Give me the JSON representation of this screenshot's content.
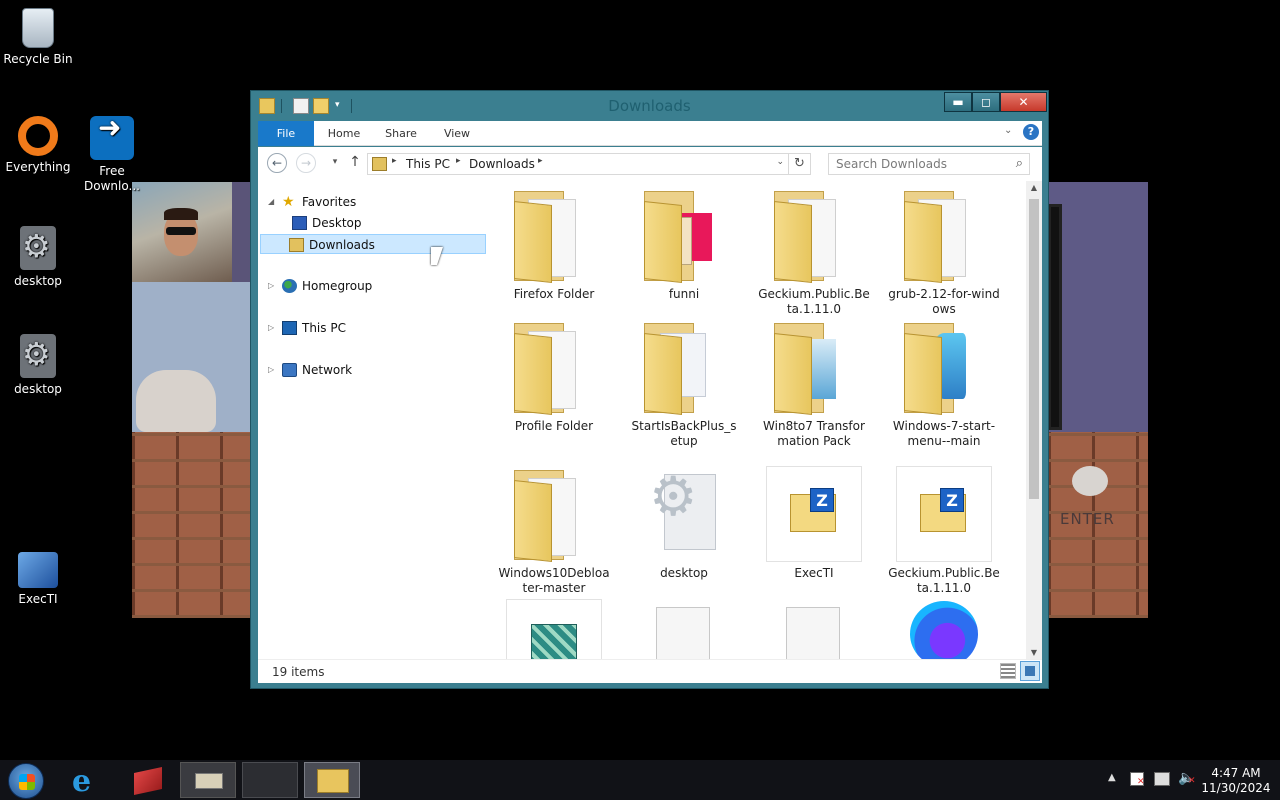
{
  "desktop": {
    "icons": [
      {
        "label": "Recycle Bin",
        "icon": "recycle-bin-icon"
      },
      {
        "label": "Everything",
        "icon": "everything-icon"
      },
      {
        "label": "Free Downlo...",
        "icon": "free-download-manager-icon"
      },
      {
        "label": "desktop",
        "icon": "settings-file-icon"
      },
      {
        "label": "desktop",
        "icon": "settings-file-icon"
      },
      {
        "label": "ExecTI",
        "icon": "execti-shield-icon"
      }
    ],
    "background_app": {
      "enter_label": "ENTER"
    }
  },
  "window": {
    "title": "Downloads",
    "controls": {
      "minimize": "▬",
      "maximize": "◻",
      "close": "✕"
    },
    "ribbon_tabs": [
      "File",
      "Home",
      "Share",
      "View"
    ],
    "help": "?",
    "address": {
      "crumbs": [
        "This PC",
        "Downloads"
      ],
      "separator": "▸"
    },
    "search": {
      "placeholder": "Search Downloads"
    },
    "nav_pane": {
      "items": [
        {
          "label": "Favorites",
          "icon": "favorites-star-icon",
          "expanded": true
        },
        {
          "label": "Desktop",
          "icon": "desktop-icon"
        },
        {
          "label": "Downloads",
          "icon": "downloads-icon",
          "selected": true
        },
        {
          "label": "Homegroup",
          "icon": "homegroup-icon"
        },
        {
          "label": "This PC",
          "icon": "this-pc-icon"
        },
        {
          "label": "Network",
          "icon": "network-icon"
        }
      ]
    },
    "files": [
      {
        "name": "Firefox Folder",
        "type": "folder"
      },
      {
        "name": "funni",
        "type": "folder"
      },
      {
        "name": "Geckium.Public.Beta.1.11.0",
        "type": "folder"
      },
      {
        "name": "grub-2.12-for-windows",
        "type": "folder"
      },
      {
        "name": "Profile Folder",
        "type": "folder"
      },
      {
        "name": "StartIsBackPlus_setup",
        "type": "folder"
      },
      {
        "name": "Win8to7 Transformation Pack",
        "type": "folder"
      },
      {
        "name": "Windows-7-start-menu--main",
        "type": "folder"
      },
      {
        "name": "Windows10Debloater-master",
        "type": "folder"
      },
      {
        "name": "desktop",
        "type": "settings-file"
      },
      {
        "name": "ExecTI",
        "type": "zip"
      },
      {
        "name": "Geckium.Public.Beta.1.11.0",
        "type": "zip"
      },
      {
        "name": "",
        "type": "installer"
      },
      {
        "name": "",
        "type": "file"
      },
      {
        "name": "",
        "type": "file"
      },
      {
        "name": "",
        "type": "firefox"
      }
    ],
    "status": {
      "item_count": "19 items"
    }
  },
  "taskbar": {
    "clock": {
      "time": "4:47 AM",
      "date": "11/30/2024"
    }
  }
}
